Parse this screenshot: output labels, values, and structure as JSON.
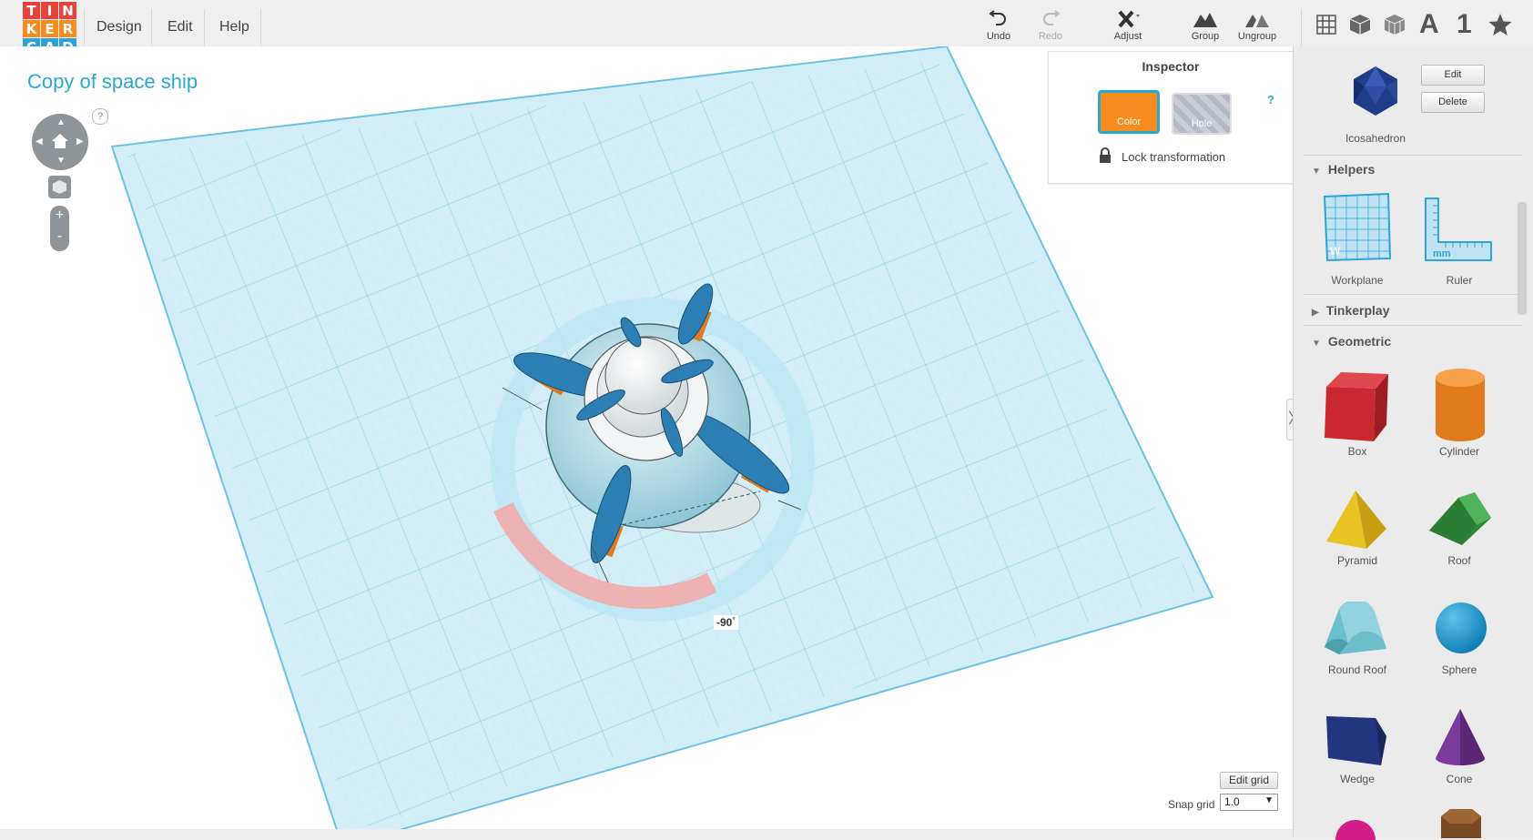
{
  "logo": {
    "letters": [
      "T",
      "I",
      "N",
      "K",
      "E",
      "R",
      "C",
      "A",
      "D"
    ],
    "colors": [
      "#e8423c",
      "#e8423c",
      "#e8423c",
      "#f68b1f",
      "#f68b1f",
      "#f68b1f",
      "#2fa3d8",
      "#2fa3d8",
      "#2fa3d8"
    ]
  },
  "menu": {
    "design": "Design",
    "edit": "Edit",
    "help": "Help"
  },
  "toolbar": {
    "undo": "Undo",
    "redo": "Redo",
    "adjust": "Adjust",
    "group": "Group",
    "ungroup": "Ungroup"
  },
  "view_icons": {
    "grid": "grid-view-icon",
    "cube": "cube-view-icon",
    "box3d": "wireframe-icon",
    "letter": "A",
    "number": "1",
    "star": "star-icon"
  },
  "design_title": "Copy of space ship",
  "navigation": {
    "help": "?",
    "zoom_in": "+",
    "zoom_out": "-"
  },
  "inspector": {
    "title": "Inspector",
    "color_label": "Color",
    "hole_label": "Hole",
    "help": "?",
    "lock_label": "Lock transformation",
    "color_value": "#f68b1f"
  },
  "rotation": {
    "label": "-90",
    "unit": "°"
  },
  "grid": {
    "edit_label": "Edit grid",
    "snap_label": "Snap grid",
    "snap_value": "1.0"
  },
  "panel": {
    "selected": {
      "name": "Icosahedron",
      "edit": "Edit",
      "delete": "Delete"
    },
    "helpers": {
      "title": "Helpers",
      "items": [
        "Workplane",
        "Ruler"
      ]
    },
    "tinkerplay": {
      "title": "Tinkerplay"
    },
    "geometric": {
      "title": "Geometric",
      "items": [
        "Box",
        "Cylinder",
        "Pyramid",
        "Roof",
        "Round Roof",
        "Sphere",
        "Wedge",
        "Cone"
      ]
    }
  }
}
